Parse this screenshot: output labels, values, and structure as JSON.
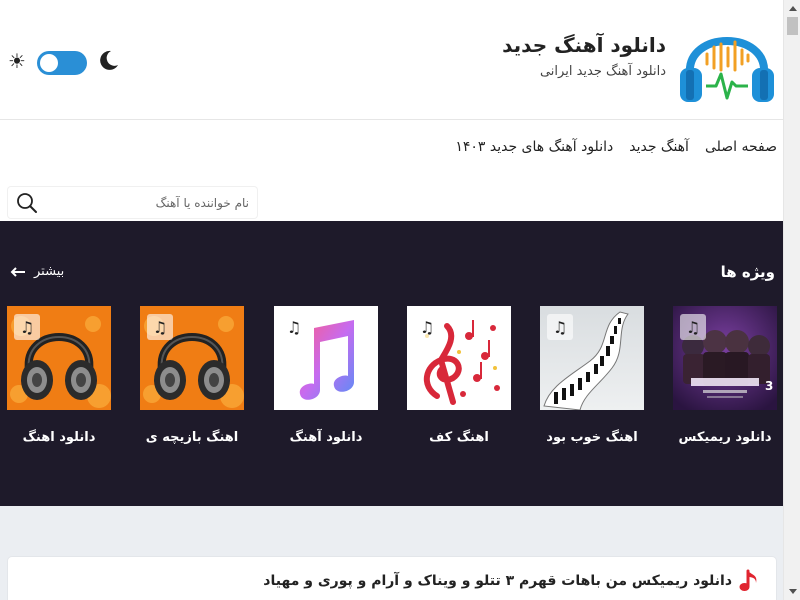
{
  "header": {
    "site_title": "دانلود آهنگ جدید",
    "site_subtitle": "دانلود آهنگ جدید ایرانی",
    "logo_icon": "headphones-sound-wave-icon",
    "theme_toggle": {
      "sun_icon": "sun-icon",
      "moon_icon": "moon-icon",
      "accent": "#2a8fd6",
      "sun_glyph": "☀"
    }
  },
  "nav": {
    "items": [
      {
        "label": "صفحه اصلی"
      },
      {
        "label": "آهنگ جدید"
      },
      {
        "label": "دانلود آهنگ های جدید ۱۴۰۳"
      }
    ]
  },
  "search": {
    "placeholder": "نام خواننده یا آهنگ",
    "value": ""
  },
  "featured": {
    "title": "ویژه ها",
    "more_label": "بیشتر",
    "background": "#1e1a2a",
    "cards": [
      {
        "label": "دانلود ریمیکس",
        "music_glyph": "♫",
        "image": "remix-poster"
      },
      {
        "label": "اهنگ خوب بود",
        "music_glyph": "♫",
        "image": "piano-stairs"
      },
      {
        "label": "اهنگ کف",
        "music_glyph": "♫",
        "image": "treble-clef-notes"
      },
      {
        "label": "دانلود آهنگ",
        "music_glyph": "♫",
        "image": "apple-music-logo"
      },
      {
        "label": "اهنگ بازیچه ی",
        "music_glyph": "♫",
        "image": "headphones-orange"
      },
      {
        "label": "دانلود اهنگ",
        "music_glyph": "♫",
        "image": "headphones-orange"
      }
    ]
  },
  "latest_post": {
    "title": "دانلود ریمیکس من باهات قهرم ۳ تتلو و ویناک و آرام و پوری و مهیاد",
    "icon": "music-note-icon"
  }
}
